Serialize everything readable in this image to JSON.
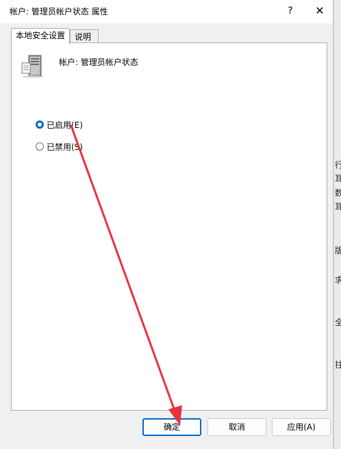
{
  "window": {
    "title": "帐户: 管理员帐户状态 属性",
    "help_label": "?",
    "close_label": "✕"
  },
  "tabs": [
    {
      "label": "本地安全设置",
      "active": true
    },
    {
      "label": "说明",
      "active": false
    }
  ],
  "policy": {
    "icon": "server-icon",
    "name": "帐户: 管理员帐户状态"
  },
  "options": [
    {
      "label": "已启用(E)",
      "checked": true
    },
    {
      "label": "已禁用(S)",
      "checked": false
    }
  ],
  "buttons": {
    "ok": "确定",
    "cancel": "取消",
    "apply": "应用(A)"
  },
  "background_fragments": [
    "行",
    "耳",
    "数",
    "耳",
    "版",
    "求",
    "全",
    "拄"
  ],
  "annotation": {
    "type": "red-arrow",
    "color": "#e8323c",
    "from": "已启用(E)",
    "to": "确定"
  }
}
